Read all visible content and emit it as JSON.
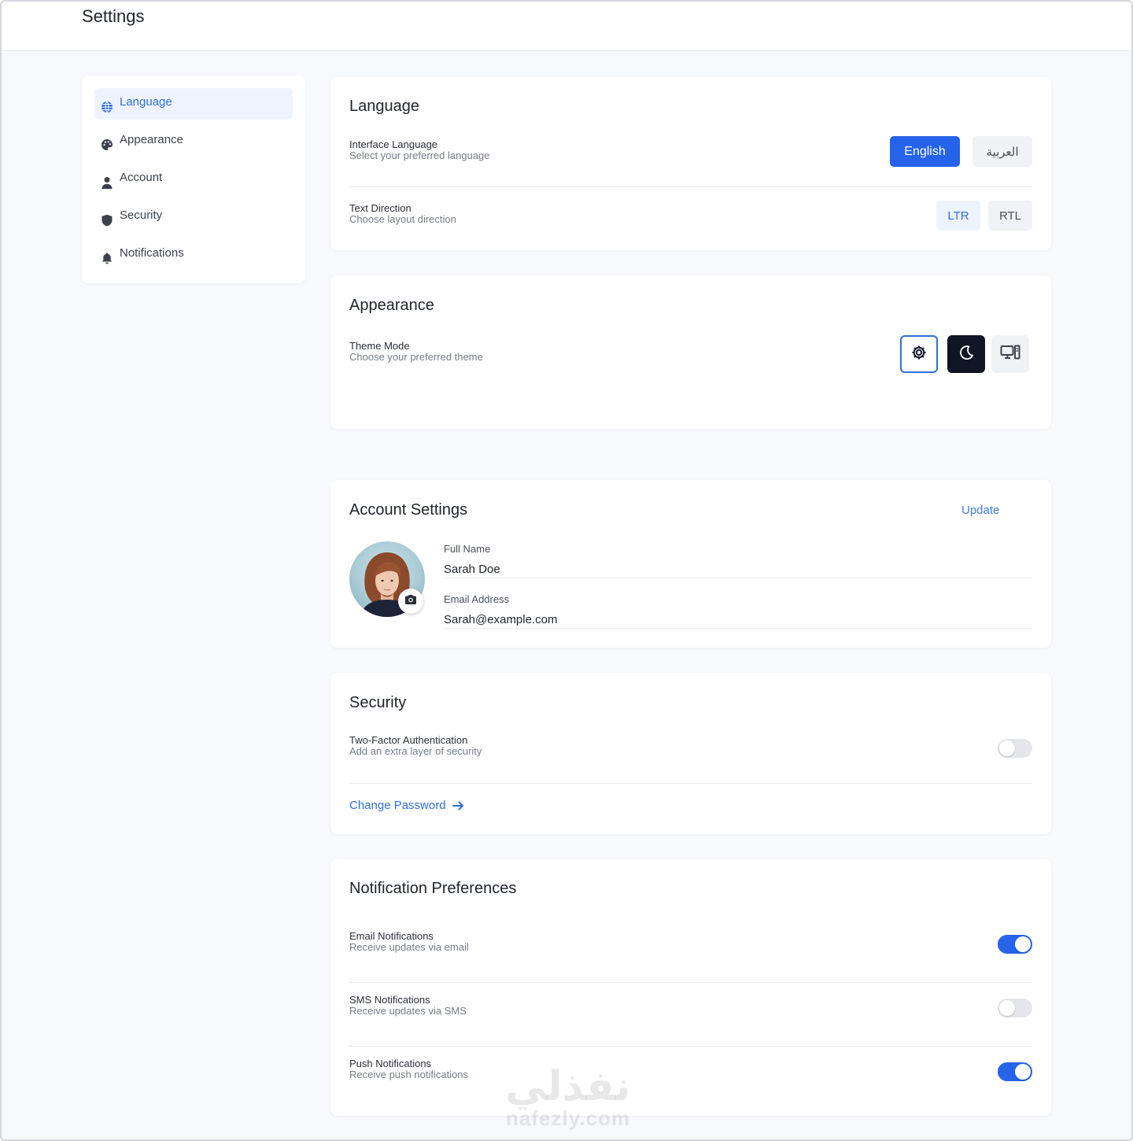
{
  "header": {
    "title": "Settings"
  },
  "sidebar": {
    "items": [
      {
        "label": "Language",
        "icon": "globe-icon",
        "active": true
      },
      {
        "label": "Appearance",
        "icon": "palette-icon",
        "active": false
      },
      {
        "label": "Account",
        "icon": "user-icon",
        "active": false
      },
      {
        "label": "Security",
        "icon": "shield-icon",
        "active": false
      },
      {
        "label": "Notifications",
        "icon": "bell-icon",
        "active": false
      }
    ]
  },
  "language": {
    "title": "Language",
    "interface_label": "Interface Language",
    "interface_desc": "Select your preferred language",
    "english": "English",
    "arabic": "العربية",
    "selected_language": "English",
    "direction_label": "Text Direction",
    "direction_desc": "Choose layout direction",
    "ltr": "LTR",
    "rtl": "RTL",
    "selected_direction": "LTR"
  },
  "appearance": {
    "title": "Appearance",
    "theme_label": "Theme Mode",
    "theme_desc": "Choose your preferred theme",
    "options": [
      "sun-gear-icon",
      "moon-icon",
      "monitor-icon"
    ],
    "selected": "light"
  },
  "account": {
    "title": "Account Settings",
    "update": "Update",
    "full_name_label": "Full Name",
    "full_name": "Sarah Doe",
    "email_label": "Email Address",
    "email": "Sarah@example.com"
  },
  "security": {
    "title": "Security",
    "twofa_label": "Two-Factor Authentication",
    "twofa_desc": "Add an extra layer of security",
    "twofa_enabled": false,
    "change_password": "Change Password"
  },
  "notifications": {
    "title": "Notification Preferences",
    "items": [
      {
        "label": "Email Notifications",
        "desc": "Receive updates via email",
        "enabled": true
      },
      {
        "label": "SMS Notifications",
        "desc": "Receive updates via SMS",
        "enabled": false
      },
      {
        "label": "Push Notifications",
        "desc": "Receive push notifications",
        "enabled": true
      }
    ]
  },
  "watermark": {
    "arabic": "نفذلي",
    "latin": "nafezly.com"
  },
  "colors": {
    "accent": "#2563eb",
    "accent_text": "#2f6fdb",
    "active_bg": "#eef4ff",
    "dark_button": "#111526",
    "toggle_off": "#e4e6ea"
  }
}
